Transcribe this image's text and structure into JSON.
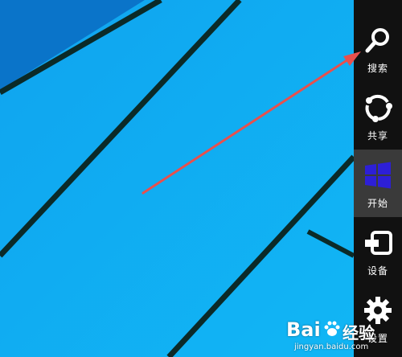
{
  "charms": [
    {
      "label": "搜索",
      "icon": "search-icon"
    },
    {
      "label": "共享",
      "icon": "share-icon"
    },
    {
      "label": "开始",
      "icon": "windows-logo-icon"
    },
    {
      "label": "设备",
      "icon": "devices-icon"
    },
    {
      "label": "设置",
      "icon": "gear-icon"
    }
  ],
  "active_charm": "开始",
  "colors": {
    "desktop_background": "#0fa8f2",
    "desktop_dark_band": "#0a6fc4",
    "desktop_lines": "#0b2a28",
    "charm_bar": "#111111",
    "charm_active": "#3a3a3a",
    "windows_logo": "#2d1fd6",
    "arrow": "#e8504d"
  },
  "watermark": {
    "brand_left": "Bai",
    "brand_right": "经验",
    "url": "jingyan.baidu.com"
  }
}
